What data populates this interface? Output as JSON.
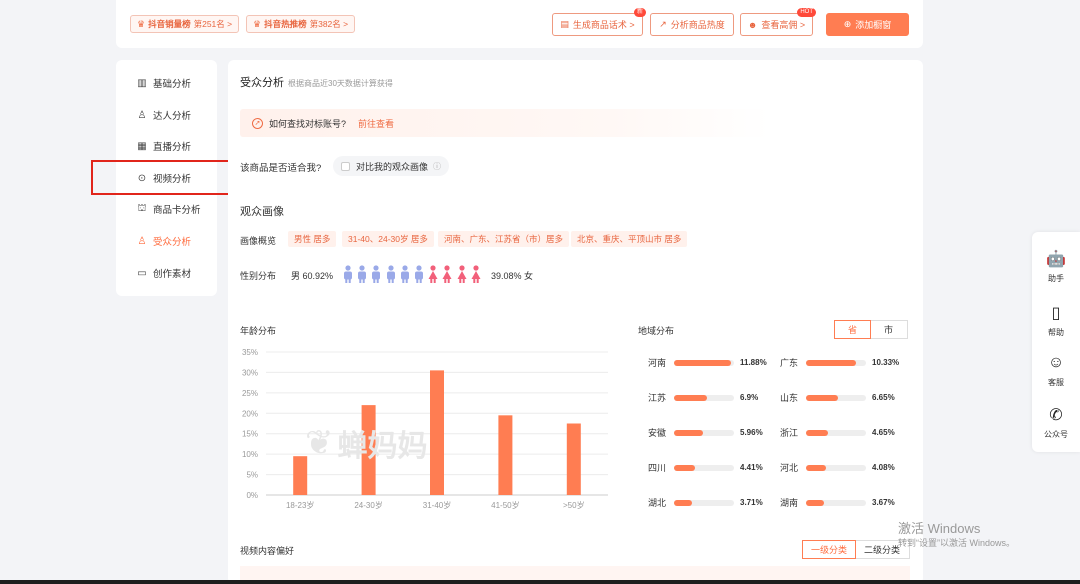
{
  "topbar": {
    "ranks": [
      {
        "name": "抖音销量榜",
        "rank": "第251名 >"
      },
      {
        "name": "抖音热推榜",
        "rank": "第382名 >"
      }
    ],
    "buttons": [
      {
        "label": "生成商品话术 >",
        "badge": "新"
      },
      {
        "label": "分析商品热度",
        "badge": ""
      },
      {
        "label": "查看高佣 >",
        "badge": "HOT"
      },
      {
        "label": "添加橱窗",
        "badge": ""
      }
    ]
  },
  "sidebar": {
    "items": [
      {
        "label": "基础分析",
        "icon": "bar-chart-icon"
      },
      {
        "label": "达人分析",
        "icon": "user-icon"
      },
      {
        "label": "直播分析",
        "icon": "live-icon"
      },
      {
        "label": "视频分析",
        "icon": "play-icon"
      },
      {
        "label": "商品卡分析",
        "icon": "bag-icon"
      },
      {
        "label": "受众分析",
        "icon": "audience-icon"
      },
      {
        "label": "创作素材",
        "icon": "folder-icon"
      }
    ],
    "active": "受众分析"
  },
  "main": {
    "title": "受众分析",
    "subtitle": "根据商品近30天数据计算获得",
    "hint": {
      "text": "如何查找对标账号?",
      "link": "前往查看"
    },
    "fit": {
      "question": "该商品是否适合我?",
      "compare": "对比我的观众画像"
    },
    "audience_title": "观众画像",
    "overview_label": "画像概览",
    "overview_tags": [
      "男性 居多",
      "31-40、24-30岁 居多",
      "河南、广东、江苏省（市）居多",
      "北京、重庆、平顶山市 居多"
    ],
    "gender": {
      "label": "性别分布",
      "male_text": "男 60.92%",
      "female_text": "39.08% 女",
      "male_share": 60.92,
      "female_share": 39.08
    },
    "age_title": "年龄分布",
    "region_title": "地域分布",
    "region_tabs": [
      "省",
      "市"
    ],
    "region_tab_active": "省",
    "regions": [
      {
        "name": "河南",
        "value": "11.88%",
        "pct": 11.88
      },
      {
        "name": "广东",
        "value": "10.33%",
        "pct": 10.33
      },
      {
        "name": "江苏",
        "value": "6.9%",
        "pct": 6.9
      },
      {
        "name": "山东",
        "value": "6.65%",
        "pct": 6.65
      },
      {
        "name": "安徽",
        "value": "5.96%",
        "pct": 5.96
      },
      {
        "name": "浙江",
        "value": "4.65%",
        "pct": 4.65
      },
      {
        "name": "四川",
        "value": "4.41%",
        "pct": 4.41
      },
      {
        "name": "河北",
        "value": "4.08%",
        "pct": 4.08
      },
      {
        "name": "湖北",
        "value": "3.71%",
        "pct": 3.71
      },
      {
        "name": "湖南",
        "value": "3.67%",
        "pct": 3.67
      }
    ],
    "video_pref_title": "视频内容偏好",
    "video_tabs": [
      "一级分类",
      "二级分类"
    ],
    "watermark": "蝉妈妈"
  },
  "chart_data": {
    "type": "bar",
    "title": "年龄分布",
    "categories": [
      "18-23岁",
      "24-30岁",
      "31-40岁",
      "41-50岁",
      ">50岁"
    ],
    "values": [
      9.5,
      22,
      30.5,
      19.5,
      17.5
    ],
    "yticks": [
      "0%",
      "5%",
      "10%",
      "15%",
      "20%",
      "25%",
      "30%",
      "35%"
    ],
    "ylim": [
      0,
      35
    ],
    "grid": true,
    "color": "#ff7d52"
  },
  "rightbar": {
    "items": [
      {
        "label": "助手",
        "icon": "robot-icon"
      },
      {
        "label": "帮助",
        "icon": "book-icon"
      },
      {
        "label": "客服",
        "icon": "headset-icon"
      },
      {
        "label": "公众号",
        "icon": "wechat-icon"
      }
    ]
  },
  "windows": {
    "line1": "激活 Windows",
    "line2": "转到“设置”以激活 Windows。"
  },
  "colors": {
    "accent": "#ff7d52",
    "accent_text": "#e8653f",
    "male": "#9aa9e8",
    "female": "#f2607a"
  }
}
